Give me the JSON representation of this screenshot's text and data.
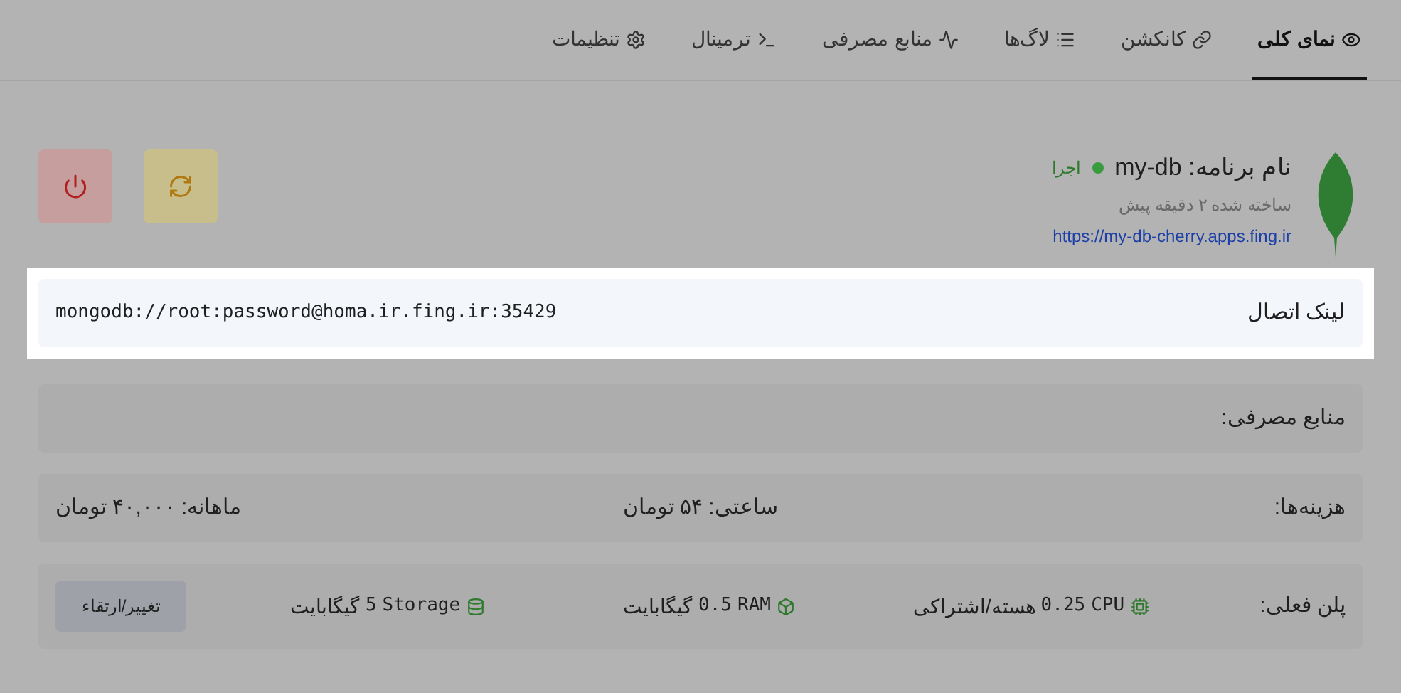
{
  "tabs": [
    {
      "label": "نمای کلی",
      "selected": true
    },
    {
      "label": "کانکشن",
      "selected": false
    },
    {
      "label": "لاگ‌ها",
      "selected": false
    },
    {
      "label": "منابع مصرفی",
      "selected": false
    },
    {
      "label": "ترمینال",
      "selected": false
    },
    {
      "label": "تنظیمات",
      "selected": false
    }
  ],
  "app": {
    "title": "نام برنامه: my-db",
    "status": "اجرا",
    "running": true,
    "created": "ساخته شده ۲ دقیقه پیش",
    "url": "https://my-db-cherry.apps.fing.ir"
  },
  "connection": {
    "label": "لینک اتصال",
    "value": "mongodb://root:password@homa.ir.fing.ir:35429"
  },
  "resources": {
    "title": "منابع مصرفی:"
  },
  "costs": {
    "label": "هزینه‌ها:",
    "hourly": "ساعتی: ۵۴ تومان",
    "monthly": "ماهانه: ۴۰,۰۰۰ تومان"
  },
  "plan": {
    "label": "پلن فعلی:",
    "items": [
      {
        "name": "CPU",
        "value": "0.25",
        "unit": "هسته/اشتراکی"
      },
      {
        "name": "RAM",
        "value": "0.5",
        "unit": "گیگابایت"
      },
      {
        "name": "Storage",
        "value": "5",
        "unit": "گیگابایت"
      }
    ],
    "button": "تغییر/ارتقاء"
  }
}
